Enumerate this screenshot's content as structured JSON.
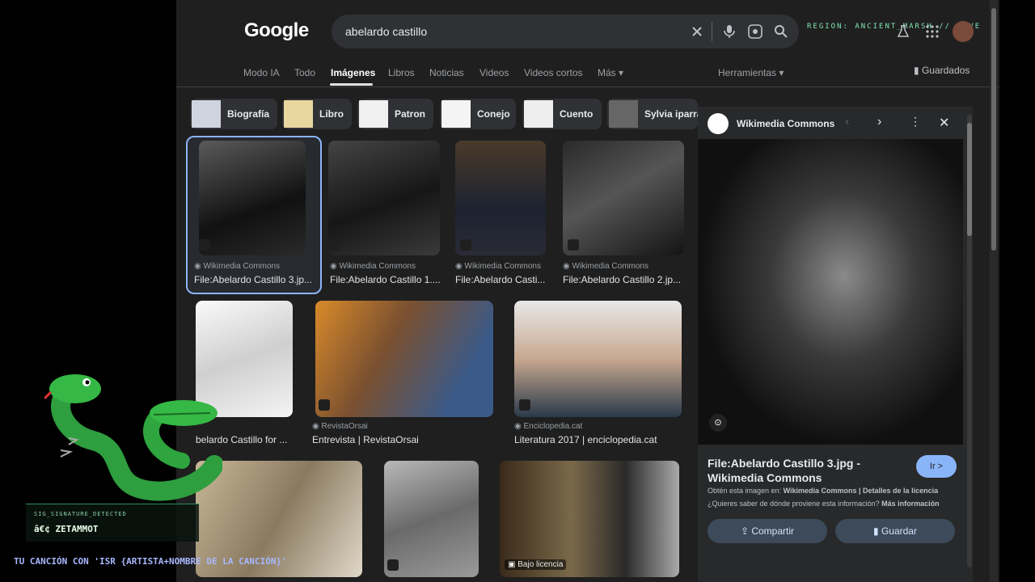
{
  "header": {
    "logo": "Google",
    "search_query": "abelardo castillo",
    "overlay_region": "REGION: ANCIENT_MARSH // LIVE",
    "saved_label": "Guardados",
    "tools_label": "Herramientas"
  },
  "tabs": [
    "Modo IA",
    "Todo",
    "Imágenes",
    "Libros",
    "Noticias",
    "Videos",
    "Videos cortos",
    "Más"
  ],
  "chips": [
    "Biografía",
    "Libro",
    "Patron",
    "Conejo",
    "Cuento",
    "Sylvia iparra"
  ],
  "results": [
    {
      "source": "Wikimedia Commons",
      "caption": "File:Abelardo Castillo 3.jp..."
    },
    {
      "source": "Wikimedia Commons",
      "caption": "File:Abelardo Castillo 1...."
    },
    {
      "source": "Wikimedia Commons",
      "caption": "File:Abelardo Casti..."
    },
    {
      "source": "Wikimedia Commons",
      "caption": "File:Abelardo Castillo 2.jp..."
    },
    {
      "source": "",
      "caption": "belardo Castillo for ..."
    },
    {
      "source": "RevistaOrsai",
      "caption": "Entrevista | RevistaOrsai"
    },
    {
      "source": "Enciclopedia.cat",
      "caption": "Literatura 2017 | enciclopedia.cat"
    },
    {
      "source": "",
      "caption": ""
    },
    {
      "source": "",
      "caption": ""
    },
    {
      "source": "",
      "caption": "Bajo licencia"
    }
  ],
  "panel": {
    "source": "Wikimedia Commons",
    "title": "File:Abelardo Castillo 3.jpg - Wikimedia Commons",
    "go_button": "Ir >",
    "info_prefix": "Obtén esta imagen en:",
    "info_links": "Wikimedia Commons | Detalles de la licencia",
    "question": "¿Quieres saber de dónde proviene esta información?",
    "more_info": "Más información",
    "share": "Compartir",
    "save": "Guardar"
  },
  "stream_overlay": {
    "signature_label": "SIG_SIGNATURE_DETECTED",
    "username": "â€¢ ZETAMMOT",
    "song_banner": "TU CANCIÓN CON 'ISR {ARTISTA+NOMBRE DE LA CANCIÓN}'"
  }
}
